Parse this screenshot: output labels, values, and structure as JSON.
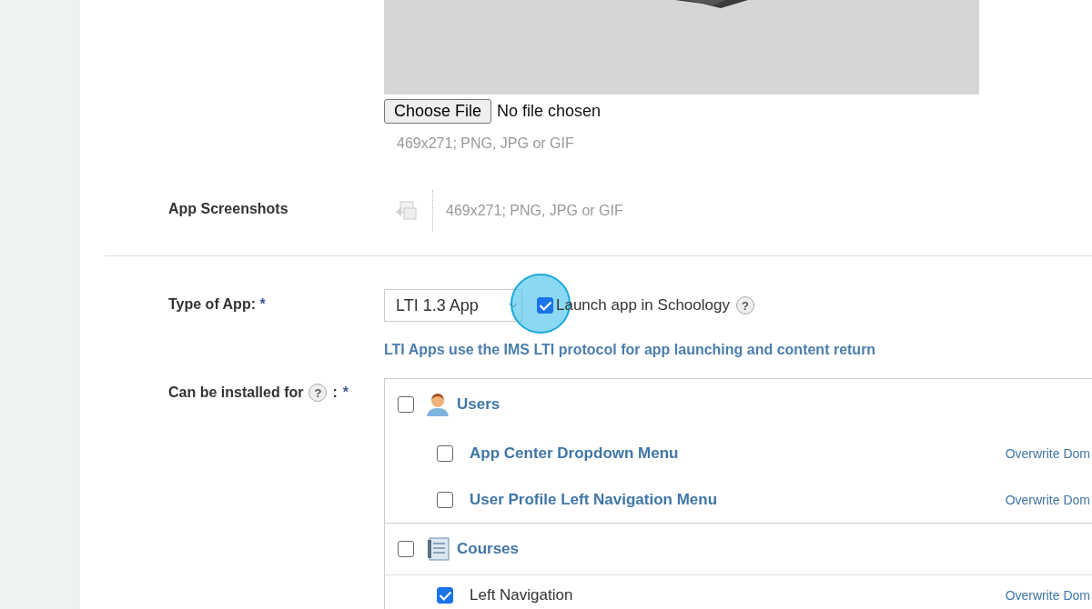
{
  "logo_upload": {
    "button": "Choose File",
    "status": "No file chosen",
    "hint": "469x271; PNG, JPG or GIF"
  },
  "screenshots": {
    "label": "App Screenshots",
    "hint": "469x271; PNG, JPG or GIF"
  },
  "type_of_app": {
    "label": "Type of App:",
    "required": "*",
    "value": "LTI 1.3 App",
    "launch_checkbox": {
      "label": "Launch app in Schoology",
      "checked": true,
      "highlighted": true
    },
    "help": "?",
    "note": "LTI Apps use the IMS LTI protocol for app launching and content return"
  },
  "install_for": {
    "label": "Can be installed for",
    "help": "?",
    "separator": ":",
    "required": "*",
    "groups": [
      {
        "name": "Users",
        "checked": false,
        "items": [
          {
            "name": "App Center Dropdown Menu",
            "checked": false,
            "link": true,
            "action": "Overwrite Dom"
          },
          {
            "name": "User Profile Left Navigation Menu",
            "checked": false,
            "link": true,
            "action": "Overwrite Dom"
          }
        ]
      },
      {
        "name": "Courses",
        "checked": false,
        "items": [
          {
            "name": "Left Navigation",
            "checked": true,
            "link": false,
            "action": "Overwrite Dom"
          }
        ]
      }
    ]
  }
}
